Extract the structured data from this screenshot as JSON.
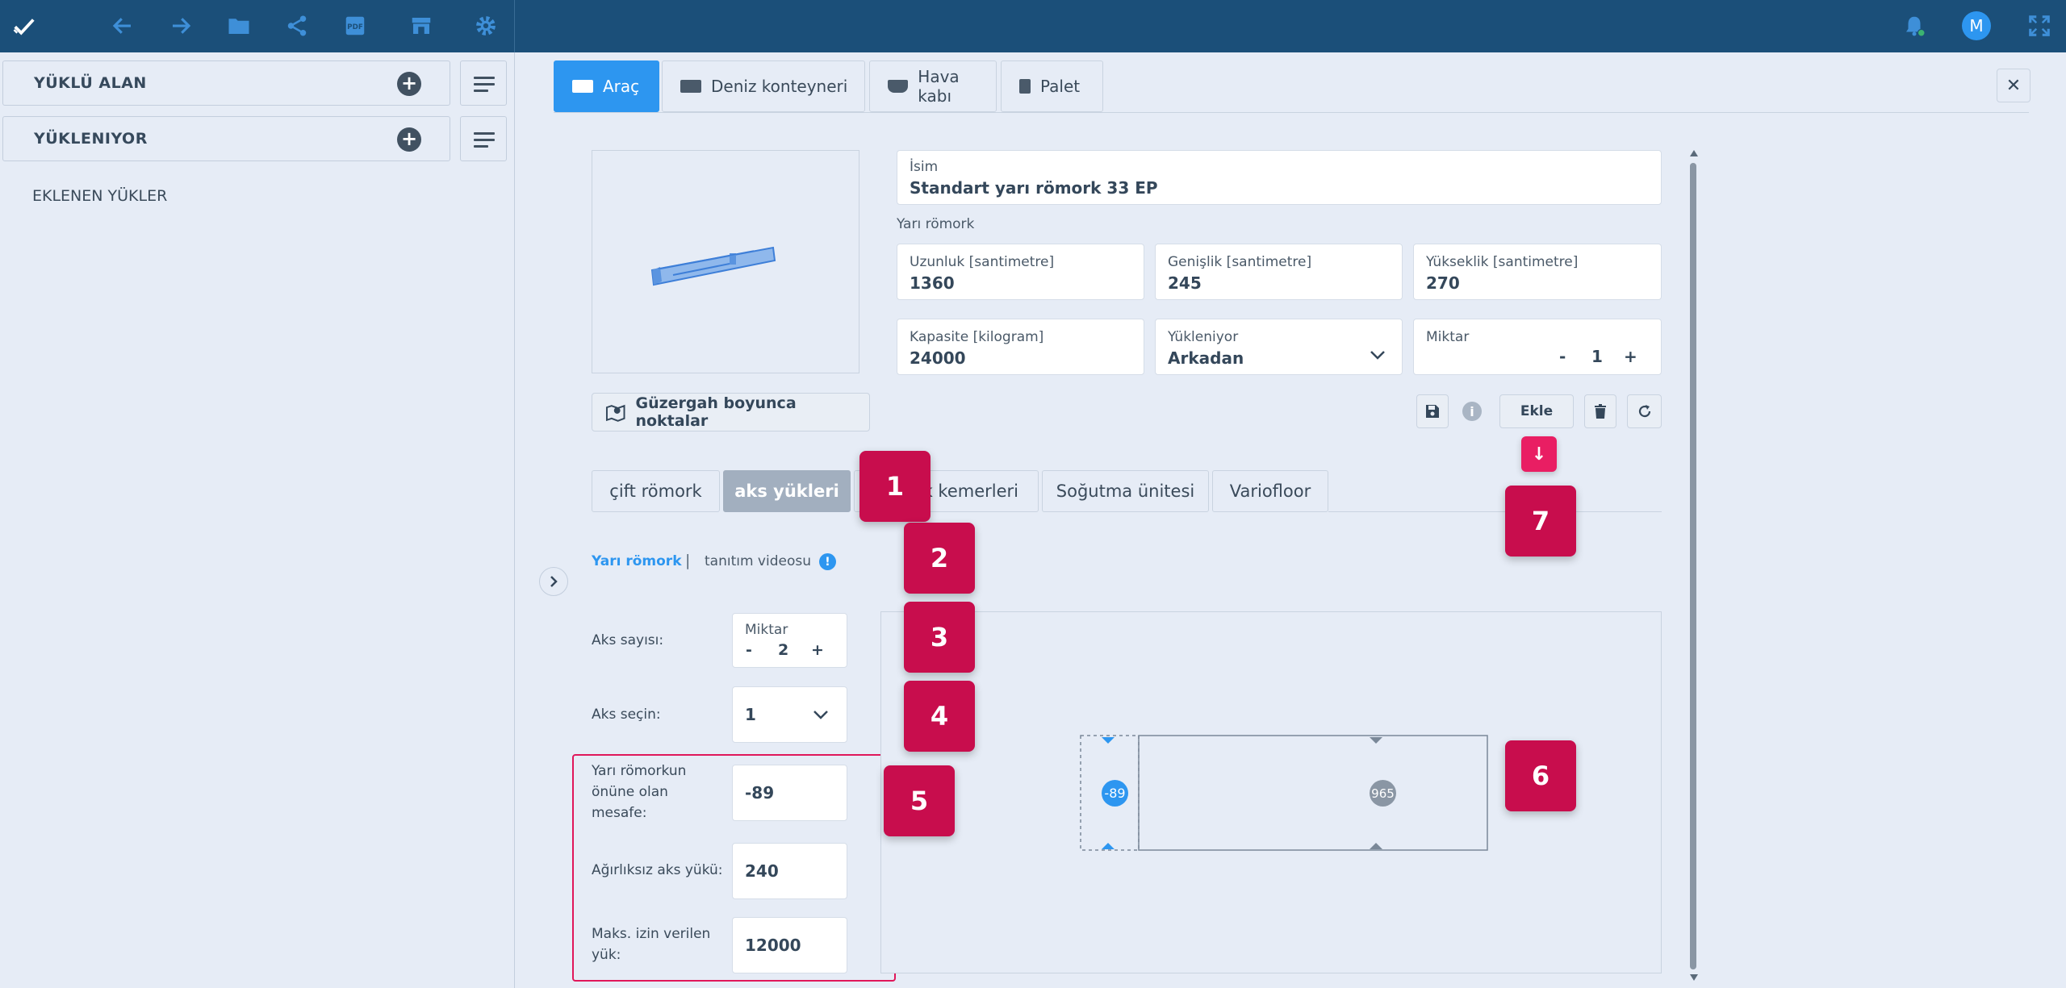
{
  "toolbar": {
    "icons": [
      "check-icon",
      "back-icon",
      "forward-icon",
      "folder-icon",
      "share-icon",
      "pdf-icon",
      "store-icon",
      "gear-icon"
    ],
    "avatar_initial": "M"
  },
  "left": {
    "loaded_area": "YÜKLÜ ALAN",
    "loading": "YÜKLENIYOR",
    "added_loads": "EKLENEN YÜKLER"
  },
  "tabs": [
    {
      "label": "Araç"
    },
    {
      "label": "Deniz konteyneri"
    },
    {
      "label": "Hava kabı"
    },
    {
      "label": "Palet"
    }
  ],
  "vehicle": {
    "name_label": "İsim",
    "name_value": "Standart yarı römork 33 EP",
    "type": "Yarı römork",
    "length_label": "Uzunluk [santimetre]",
    "length_value": "1360",
    "width_label": "Genişlik [santimetre]",
    "width_value": "245",
    "height_label": "Yükseklik [santimetre]",
    "height_value": "270",
    "capacity_label": "Kapasite [kilogram]",
    "capacity_value": "24000",
    "loading_label": "Yükleniyor",
    "loading_value": "Arkadan",
    "qty_label": "Miktar",
    "qty_minus": "-",
    "qty_value": "1",
    "qty_plus": "+"
  },
  "actions": {
    "route_points": "Güzergah boyunca noktalar",
    "add": "Ekle"
  },
  "subtabs": [
    "çift römork",
    "aks yükleri",
    "k kemerleri",
    "Soğutma ünitesi",
    "Variofloor"
  ],
  "links": {
    "semi_trailer": "Yarı römork",
    "separator": "|",
    "video": "tanıtım videosu"
  },
  "axle": {
    "count_label": "Aks sayısı:",
    "count_box_label": "Miktar",
    "count_minus": "-",
    "count_value": "2",
    "count_plus": "+",
    "select_label": "Aks seçin:",
    "select_value": "1",
    "dist_label_1": "Yarı römorkun",
    "dist_label_2": "önüne olan",
    "dist_label_3": "mesafe:",
    "dist_value": "-89",
    "empty_label": "Ağırlıksız aks yükü:",
    "empty_value": "240",
    "max_label_1": "Maks. izin verilen",
    "max_label_2": "yük:",
    "max_value": "12000"
  },
  "diagram": {
    "marker_left": "-89",
    "marker_right": "965"
  },
  "badges": [
    "1",
    "2",
    "3",
    "4",
    "5",
    "6",
    "7"
  ],
  "colors": {
    "topbar": "#1b4f79",
    "accent": "#2d96f0",
    "badge": "#c80d4d",
    "callout": "#e91e63"
  }
}
